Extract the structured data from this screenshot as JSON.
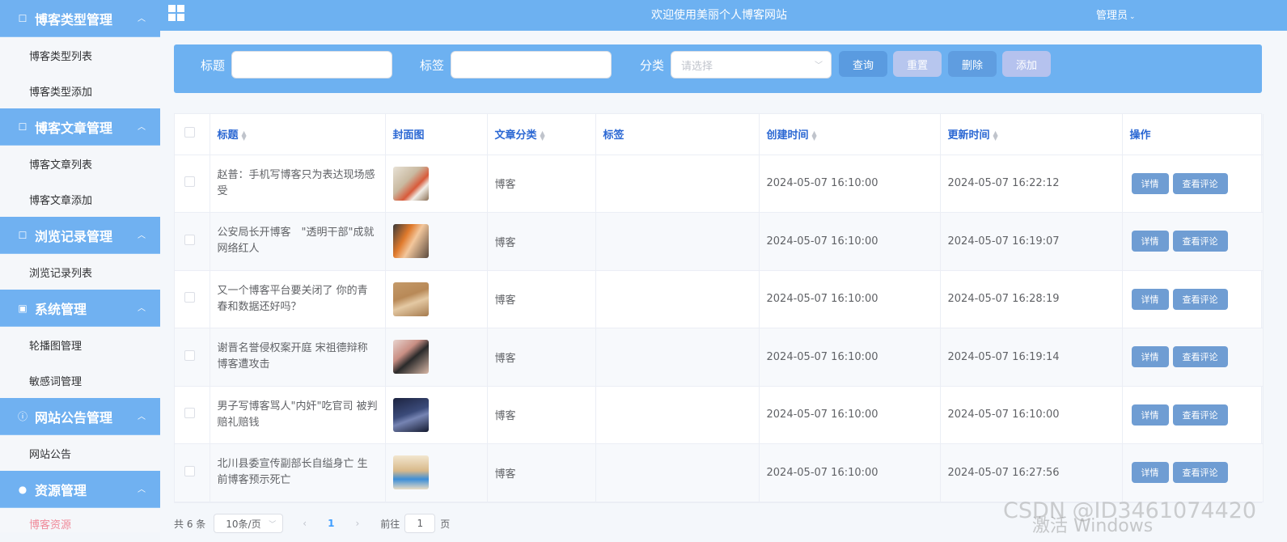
{
  "header": {
    "welcome": "欢迎使用美丽个人博客网站",
    "user_label": "管理员"
  },
  "sidebar": {
    "groups": [
      {
        "title": "博客类型管理",
        "icon": "edit-icon",
        "items": [
          "博客类型列表",
          "博客类型添加"
        ]
      },
      {
        "title": "博客文章管理",
        "icon": "edit-icon",
        "items": [
          "博客文章列表",
          "博客文章添加"
        ]
      },
      {
        "title": "浏览记录管理",
        "icon": "edit-icon",
        "items": [
          "浏览记录列表"
        ]
      },
      {
        "title": "系统管理",
        "icon": "picture-icon",
        "items": [
          "轮播图管理",
          "敏感词管理"
        ]
      },
      {
        "title": "网站公告管理",
        "icon": "info-icon",
        "items": [
          "网站公告"
        ]
      },
      {
        "title": "资源管理",
        "icon": "location-icon",
        "items": [
          "博客资源"
        ]
      }
    ]
  },
  "search": {
    "title_label": "标题",
    "title_value": "",
    "tag_label": "标签",
    "tag_value": "",
    "category_label": "分类",
    "category_placeholder": "请选择",
    "query_button": "查询",
    "reset_button": "重置",
    "delete_button": "删除",
    "add_button": "添加"
  },
  "table": {
    "columns": [
      "标题",
      "封面图",
      "文章分类",
      "标签",
      "创建时间",
      "更新时间",
      "操作"
    ],
    "detail_button": "详情",
    "comments_button": "查看评论",
    "rows": [
      {
        "title": "赵普：手机写博客只为表达现场感受",
        "category": "博客",
        "tags": "",
        "created": "2024-05-07 16:10:00",
        "updated": "2024-05-07 16:22:12"
      },
      {
        "title": "公安局长开博客　\"透明干部\"成就网络红人",
        "category": "博客",
        "tags": "",
        "created": "2024-05-07 16:10:00",
        "updated": "2024-05-07 16:19:07"
      },
      {
        "title": "又一个博客平台要关闭了 你的青春和数据还好吗？",
        "category": "博客",
        "tags": "",
        "created": "2024-05-07 16:10:00",
        "updated": "2024-05-07 16:28:19"
      },
      {
        "title": "谢晋名誉侵权案开庭 宋祖德辩称博客遭攻击",
        "category": "博客",
        "tags": "",
        "created": "2024-05-07 16:10:00",
        "updated": "2024-05-07 16:19:14"
      },
      {
        "title": "男子写博客骂人\"内奸\"吃官司 被判赔礼赔钱",
        "category": "博客",
        "tags": "",
        "created": "2024-05-07 16:10:00",
        "updated": "2024-05-07 16:10:00"
      },
      {
        "title": "北川县委宣传副部长自缢身亡 生前博客预示死亡",
        "category": "博客",
        "tags": "",
        "created": "2024-05-07 16:10:00",
        "updated": "2024-05-07 16:27:56"
      }
    ]
  },
  "pagination": {
    "total": "共 6 条",
    "page_size": "10条/页",
    "current_page": "1",
    "goto_label": "前往",
    "goto_value": "1",
    "page_suffix": "页"
  },
  "watermarks": {
    "csdn": "CSDN @ID3461074420",
    "windows": "激活 Windows"
  },
  "colors": {
    "primary": "#6db1f1",
    "link": "#2a67d3",
    "op_button": "#6f9dd3"
  }
}
